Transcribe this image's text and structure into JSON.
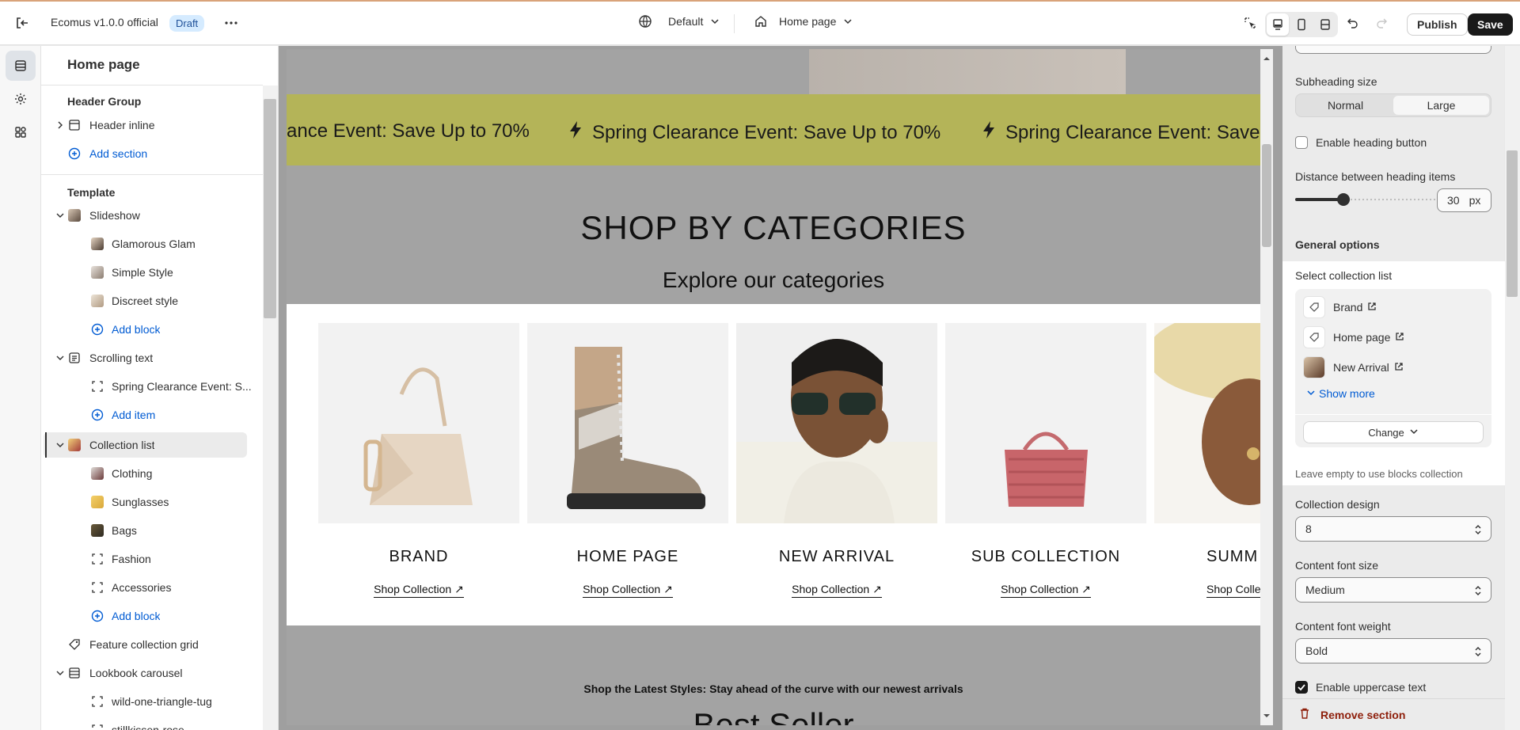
{
  "topbar": {
    "exit_icon": "exit-icon",
    "theme_name": "Ecomus v1.0.0 official",
    "status_badge": "Draft",
    "more_icon": "more-horizontal-icon",
    "locale_label": "Default",
    "page_label": "Home page",
    "publish_label": "Publish",
    "save_label": "Save"
  },
  "rail": {
    "items": [
      "sections-icon",
      "settings-gear-icon",
      "apps-icon"
    ],
    "active": 0
  },
  "sidebar": {
    "title": "Home page",
    "header_group": {
      "label": "Header Group",
      "items": [
        "Header inline"
      ],
      "add_section": "Add section"
    },
    "template": {
      "label": "Template",
      "slideshow": {
        "label": "Slideshow",
        "blocks": [
          "Glamorous Glam",
          "Simple Style",
          "Discreet style"
        ],
        "add_block": "Add block"
      },
      "scrolling_text": {
        "label": "Scrolling text",
        "blocks": [
          "Spring Clearance Event: S..."
        ],
        "add_item": "Add item"
      },
      "collection_list": {
        "label": "Collection list",
        "blocks": [
          "Clothing",
          "Sunglasses",
          "Bags",
          "Fashion",
          "Accessories"
        ],
        "add_block": "Add block"
      },
      "feature_collection_grid": "Feature collection grid",
      "lookbook_carousel": {
        "label": "Lookbook carousel",
        "blocks": [
          "wild-one-triangle-tug",
          "stillkissen-rose"
        ]
      }
    }
  },
  "preview": {
    "marquee_text": "Spring Clearance Event: Save Up to 70%",
    "marquee_partial_left": "ance Event: Save Up to 70%",
    "marquee_partial_right": "Spring Clearance Event: Save",
    "heading": "SHOP BY CATEGORIES",
    "subheading": "Explore our categories",
    "cards": [
      {
        "name": "BRAND",
        "link": "Shop Collection"
      },
      {
        "name": "HOME PAGE",
        "link": "Shop Collection"
      },
      {
        "name": "NEW ARRIVAL",
        "link": "Shop Collection"
      },
      {
        "name": "SUB COLLECTION",
        "link": "Shop Collection"
      },
      {
        "name": "SUMM",
        "link": "Shop Colle"
      }
    ],
    "latest_text": "Shop the Latest Styles: Stay ahead of the curve with our newest arrivals",
    "best_seller": "Best Seller"
  },
  "settings": {
    "subheading_size_label": "Subheading size",
    "subheading_size_options": [
      "Normal",
      "Large"
    ],
    "subheading_size_selected": "Large",
    "enable_heading_button": "Enable heading button",
    "distance_label": "Distance between heading items",
    "distance_value": "30",
    "distance_unit": "px",
    "distance_fraction": 0.33,
    "general_options": "General options",
    "select_collection_label": "Select collection list",
    "collections": [
      "Brand",
      "Home page",
      "New Arrival"
    ],
    "show_more": "Show more",
    "change_label": "Change",
    "leave_empty_hint": "Leave empty to use blocks collection",
    "collection_design_label": "Collection design",
    "collection_design_value": "8",
    "content_font_size_label": "Content font size",
    "content_font_size_value": "Medium",
    "content_font_weight_label": "Content font weight",
    "content_font_weight_value": "Bold",
    "enable_uppercase": "Enable uppercase text",
    "remove_section": "Remove section"
  },
  "colors": {
    "marquee_bg": "#b4b458",
    "link_blue": "#005bd3",
    "danger": "#8e1f0b"
  }
}
